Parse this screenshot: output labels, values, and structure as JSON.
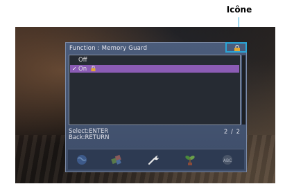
{
  "annotation": {
    "label": "Icône"
  },
  "menu": {
    "title": "Function : Memory Guard",
    "title_icon": "lock-icon",
    "items": [
      {
        "label": "Off",
        "selected": false
      },
      {
        "label": "On",
        "selected": true,
        "icon": "lock-icon",
        "checkmark": "✓"
      }
    ]
  },
  "footer": {
    "select_hint": "Select:ENTER",
    "back_hint": "Back:RETURN",
    "page": "2 / 2"
  },
  "icon_bar": [
    "globe-icon",
    "puzzle-icon",
    "wrench-icon",
    "plant-icon",
    "abc-icon"
  ],
  "colors": {
    "callout": "#2aa6d8",
    "osd_bg": "#44546f",
    "selection": "#8b5cb5"
  }
}
